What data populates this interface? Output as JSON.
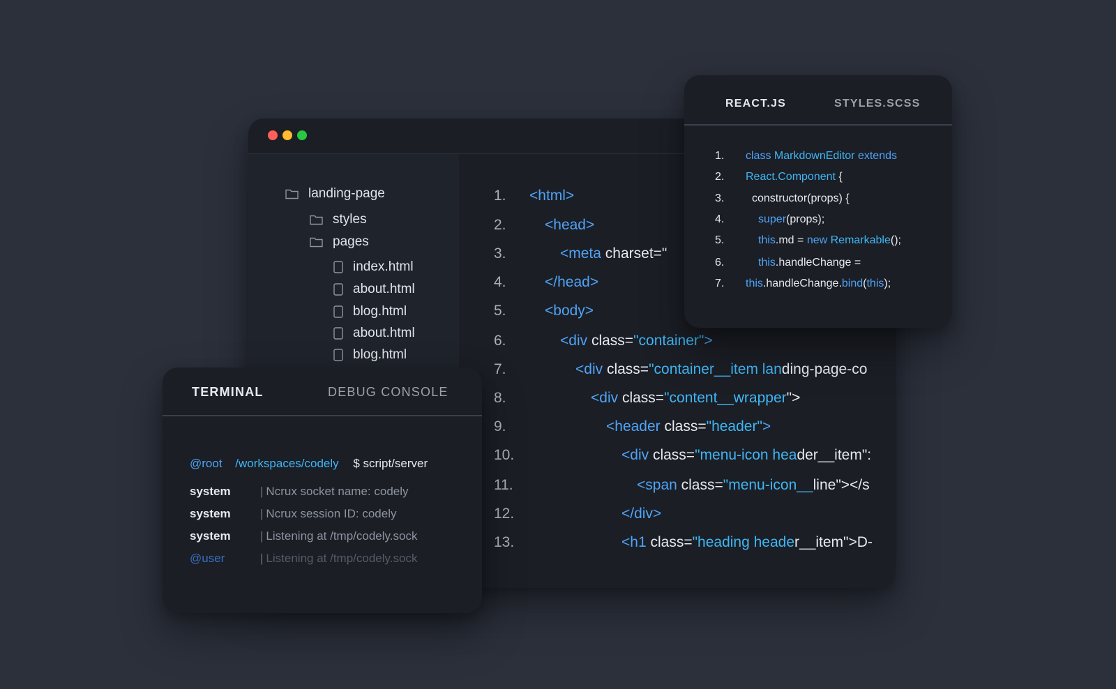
{
  "colors": {
    "background": "#2b303b",
    "window": "#1b1e25",
    "sidebar": "#1f232b",
    "tag": "#4fa3f7",
    "string": "#3fb6f5",
    "text": "#e6e9ee",
    "dot_close": "#ff5f57",
    "dot_minimize": "#febc2e",
    "dot_maximize": "#28c840"
  },
  "file_tree": [
    {
      "label": "landing-page",
      "icon": "folder-icon"
    },
    {
      "label": "styles",
      "icon": "folder-icon"
    },
    {
      "label": "pages",
      "icon": "folder-icon"
    },
    {
      "label": "index.html",
      "icon": "file-icon"
    },
    {
      "label": "about.html",
      "icon": "file-icon"
    },
    {
      "label": "blog.html",
      "icon": "file-icon"
    },
    {
      "label": "about.html",
      "icon": "file-icon"
    },
    {
      "label": "blog.html",
      "icon": "file-icon"
    }
  ],
  "code_lines": [
    {
      "num": "1.",
      "segments": [
        {
          "t": "tag",
          "v": "<html>"
        }
      ]
    },
    {
      "num": "2.",
      "segments": [
        {
          "t": "tag",
          "v": "<head>"
        }
      ]
    },
    {
      "num": "3.",
      "segments": [
        {
          "t": "tag",
          "v": "<meta "
        },
        {
          "t": "text",
          "v": "charset=\""
        }
      ]
    },
    {
      "num": "4.",
      "segments": [
        {
          "t": "tag",
          "v": "</head>"
        }
      ]
    },
    {
      "num": "5.",
      "segments": [
        {
          "t": "tag",
          "v": "<body>"
        }
      ]
    },
    {
      "num": "6.",
      "segments": [
        {
          "t": "tag",
          "v": "<div "
        },
        {
          "t": "text",
          "v": "class="
        },
        {
          "t": "string",
          "v": "\"container\""
        },
        {
          "t": "tag",
          "v": ">"
        }
      ]
    },
    {
      "num": "7.",
      "segments": [
        {
          "t": "tag",
          "v": "<div "
        },
        {
          "t": "text",
          "v": "class="
        },
        {
          "t": "string",
          "v": "\"container__item lan"
        },
        {
          "t": "text",
          "v": "ding-page-co"
        }
      ]
    },
    {
      "num": "8.",
      "segments": [
        {
          "t": "tag",
          "v": "<div "
        },
        {
          "t": "text",
          "v": "class="
        },
        {
          "t": "string",
          "v": "\"content__wrapper"
        },
        {
          "t": "text",
          "v": "\">"
        }
      ]
    },
    {
      "num": "9.",
      "segments": [
        {
          "t": "tag",
          "v": "<header "
        },
        {
          "t": "text",
          "v": "class="
        },
        {
          "t": "string",
          "v": "\"header\""
        },
        {
          "t": "tag",
          "v": ">"
        }
      ]
    },
    {
      "num": "10.",
      "segments": [
        {
          "t": "tag",
          "v": "<div "
        },
        {
          "t": "text",
          "v": "class="
        },
        {
          "t": "string",
          "v": "\"menu-icon hea"
        },
        {
          "t": "text",
          "v": "der__item\":"
        }
      ]
    },
    {
      "num": "11.",
      "segments": [
        {
          "t": "tag",
          "v": "<span "
        },
        {
          "t": "text",
          "v": "class="
        },
        {
          "t": "string",
          "v": "\"menu-icon__"
        },
        {
          "t": "text",
          "v": "line\"></s"
        }
      ]
    },
    {
      "num": "12.",
      "segments": [
        {
          "t": "tag",
          "v": "</div>"
        }
      ]
    },
    {
      "num": "13.",
      "segments": [
        {
          "t": "tag",
          "v": "<h1 "
        },
        {
          "t": "text",
          "v": "class="
        },
        {
          "t": "string",
          "v": "\"heading heade"
        },
        {
          "t": "text",
          "v": "r__item\">D-"
        }
      ]
    }
  ],
  "react_panel": {
    "tabs": [
      "REACT.JS",
      "STYLES.SCSS"
    ],
    "lines": [
      {
        "num": "1.",
        "segments": [
          {
            "t": "tag",
            "v": "class "
          },
          {
            "t": "string",
            "v": "MarkdownEditor "
          },
          {
            "t": "tag",
            "v": "extends"
          }
        ]
      },
      {
        "num": "2.",
        "segments": [
          {
            "t": "string",
            "v": "React.Component "
          },
          {
            "t": "text",
            "v": "{"
          }
        ]
      },
      {
        "num": "3.",
        "segments": [
          {
            "t": "text",
            "v": "constructor(props) {"
          }
        ]
      },
      {
        "num": "4.",
        "segments": [
          {
            "t": "tag",
            "v": "super"
          },
          {
            "t": "text",
            "v": "(props);"
          }
        ]
      },
      {
        "num": "5.",
        "segments": [
          {
            "t": "tag",
            "v": "this"
          },
          {
            "t": "text",
            "v": ".md = "
          },
          {
            "t": "tag",
            "v": "new "
          },
          {
            "t": "string",
            "v": "Remarkable"
          },
          {
            "t": "text",
            "v": "();"
          }
        ]
      },
      {
        "num": "6.",
        "segments": [
          {
            "t": "tag",
            "v": "this"
          },
          {
            "t": "text",
            "v": ".handleChange ="
          }
        ]
      },
      {
        "num": "7.",
        "segments": [
          {
            "t": "tag",
            "v": "this"
          },
          {
            "t": "text",
            "v": ".handleChange."
          },
          {
            "t": "tag",
            "v": "bind"
          },
          {
            "t": "text",
            "v": "("
          },
          {
            "t": "tag",
            "v": "this"
          },
          {
            "t": "text",
            "v": ");"
          }
        ]
      }
    ]
  },
  "terminal": {
    "tabs": [
      "TERMINAL",
      "DEBUG CONSOLE"
    ],
    "prompt": {
      "user": "@root",
      "path": "/workspaces/codely",
      "command": "$ script/server"
    },
    "rows": [
      {
        "who": "system",
        "msg": "Ncrux socket name: codely"
      },
      {
        "who": "system",
        "msg": "Ncrux session ID: codely"
      },
      {
        "who": "system",
        "msg": "Listening at /tmp/codely.sock"
      },
      {
        "who": "@user",
        "msg": "Listening at /tmp/codely.sock"
      }
    ]
  }
}
